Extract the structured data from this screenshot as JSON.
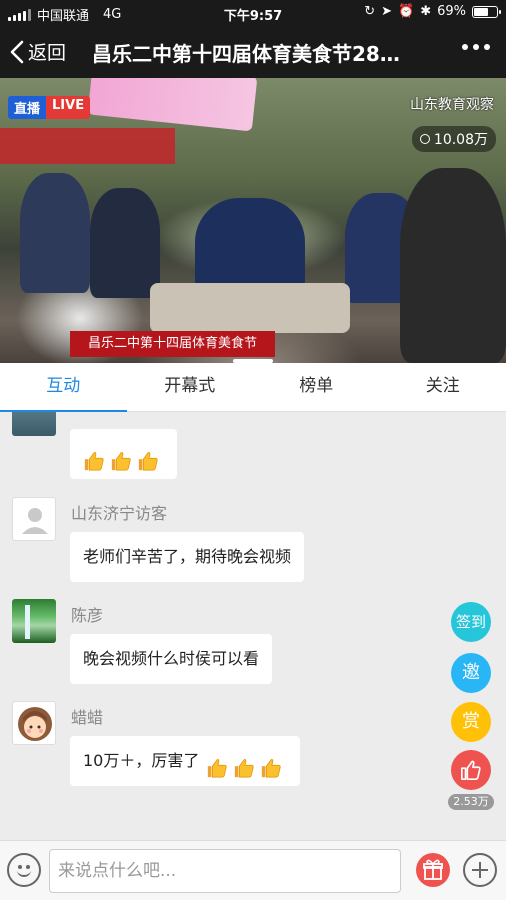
{
  "status_bar": {
    "carrier": "中国联通",
    "network": "4G",
    "time": "下午9:57",
    "battery": "69%",
    "battery_level": 0.69
  },
  "nav": {
    "back_label": "返回",
    "title": "昌乐二中第十四届体育美食节28…"
  },
  "video": {
    "live_cn": "直播",
    "live_en": "LIVE",
    "channel": "山东教育观察",
    "viewers": "10.08万",
    "caption": "昌乐二中第十四届体育美食节"
  },
  "tabs": [
    {
      "label": "互动",
      "active": true
    },
    {
      "label": "开幕式",
      "active": false
    },
    {
      "label": "榜单",
      "active": false
    },
    {
      "label": "关注",
      "active": false
    }
  ],
  "messages": [
    {
      "nick": "",
      "text": "",
      "thumbs": 3,
      "avatar": "landscape"
    },
    {
      "nick": "山东济宁访客",
      "text": "老师们辛苦了，期待晚会视频",
      "thumbs": 0,
      "avatar": "default-user"
    },
    {
      "nick": "陈彦",
      "text": "晚会视频什么时侯可以看",
      "thumbs": 0,
      "avatar": "waterfall"
    },
    {
      "nick": "蜡蜡",
      "text": "10万＋，厉害了",
      "thumbs": 3,
      "avatar": "cartoon-girl"
    }
  ],
  "side_buttons": {
    "checkin": "签到",
    "invite": "邀",
    "reward": "赏",
    "likes": "2.53万"
  },
  "input": {
    "placeholder": "来说点什么吧..."
  },
  "colors": {
    "accent": "#1e88e5",
    "checkin": "#26c6da",
    "invite": "#29b6f6",
    "reward": "#ffc107",
    "like": "#ef5350"
  }
}
